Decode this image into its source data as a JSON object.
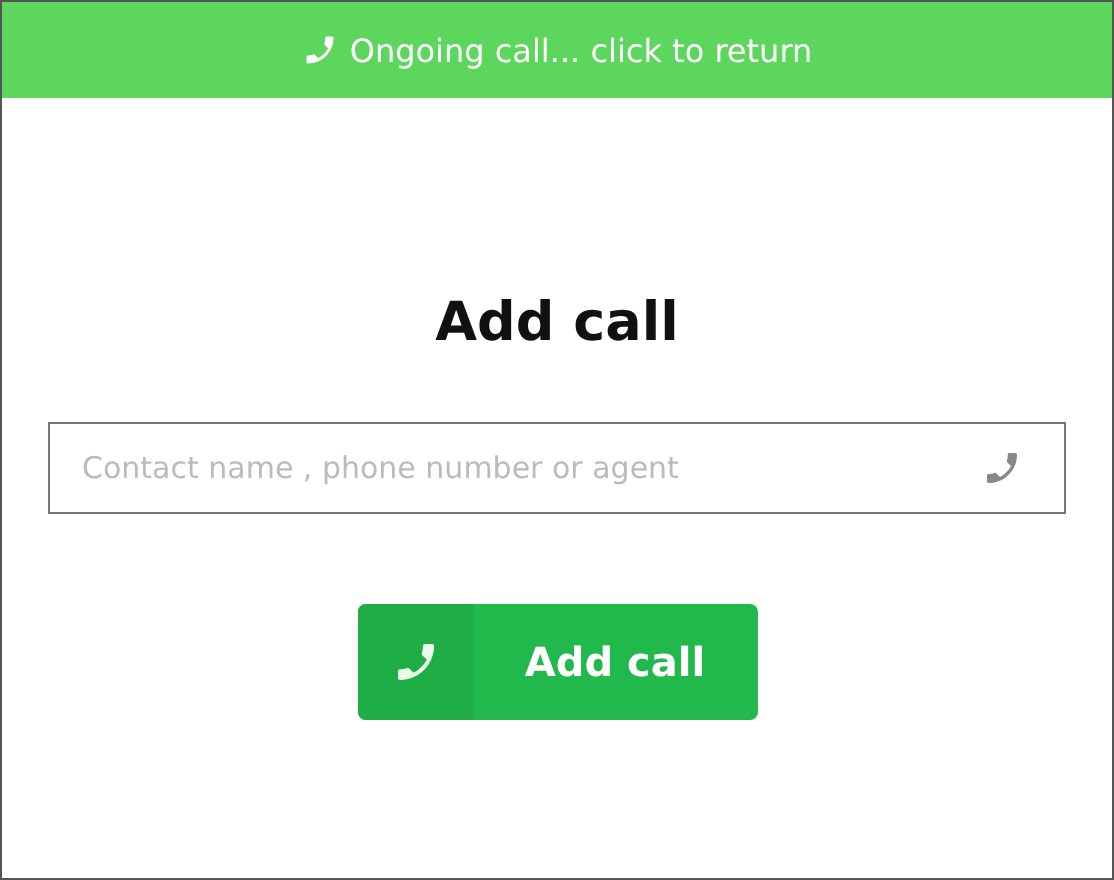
{
  "banner": {
    "text": "Ongoing call... click to return"
  },
  "title": "Add call",
  "search": {
    "placeholder": "Contact name , phone number or agent"
  },
  "button": {
    "label": "Add call"
  }
}
